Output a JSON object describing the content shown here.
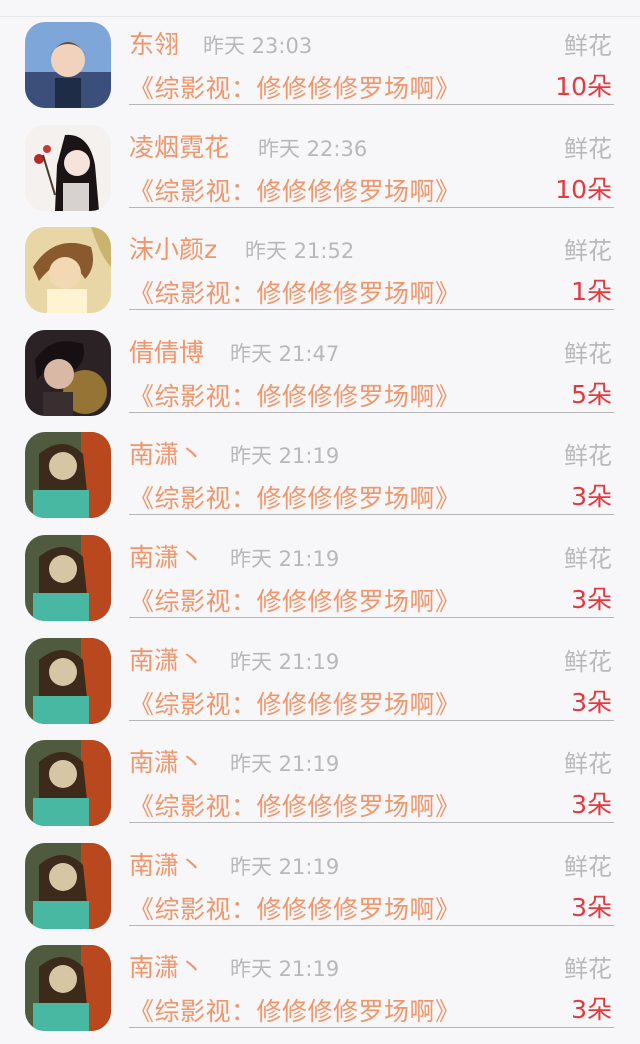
{
  "rows": [
    {
      "name": "东翎",
      "time": "昨天 23:03",
      "gift": "鲜花",
      "book": "《综影视：修修修修罗场啊》",
      "count": "10朵"
    },
    {
      "name": "凌烟霓花",
      "time": "昨天 22:36",
      "gift": "鲜花",
      "book": "《综影视：修修修修罗场啊》",
      "count": "10朵"
    },
    {
      "name": "沫小颜z",
      "time": "昨天 21:52",
      "gift": "鲜花",
      "book": "《综影视：修修修修罗场啊》",
      "count": "1朵"
    },
    {
      "name": "倩倩博",
      "time": "昨天 21:47",
      "gift": "鲜花",
      "book": "《综影视：修修修修罗场啊》",
      "count": "5朵"
    },
    {
      "name": "南潇丶",
      "time": "昨天 21:19",
      "gift": "鲜花",
      "book": "《综影视：修修修修罗场啊》",
      "count": "3朵"
    },
    {
      "name": "南潇丶",
      "time": "昨天 21:19",
      "gift": "鲜花",
      "book": "《综影视：修修修修罗场啊》",
      "count": "3朵"
    },
    {
      "name": "南潇丶",
      "time": "昨天 21:19",
      "gift": "鲜花",
      "book": "《综影视：修修修修罗场啊》",
      "count": "3朵"
    },
    {
      "name": "南潇丶",
      "time": "昨天 21:19",
      "gift": "鲜花",
      "book": "《综影视：修修修修罗场啊》",
      "count": "3朵"
    },
    {
      "name": "南潇丶",
      "time": "昨天 21:19",
      "gift": "鲜花",
      "book": "《综影视：修修修修罗场啊》",
      "count": "3朵"
    },
    {
      "name": "南潇丶",
      "time": "昨天 21:19",
      "gift": "鲜花",
      "book": "《综影视：修修修修罗场啊》",
      "count": "3朵"
    }
  ]
}
